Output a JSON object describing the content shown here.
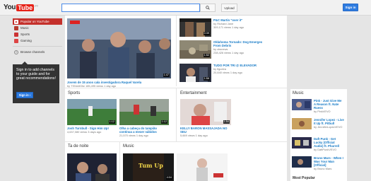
{
  "header": {
    "logo_you": "You",
    "logo_tube": "Tube",
    "logo_tld": "PT",
    "upload_label": "Upload",
    "signin_label": "Sign in"
  },
  "sidebar": {
    "items": [
      {
        "label": "Popular on YouTube",
        "color": "#ffffff"
      },
      {
        "label": "Music",
        "color": "#cc3333"
      },
      {
        "label": "Sports",
        "color": "#cc3333"
      },
      {
        "label": "Gaming",
        "color": "#cc3333"
      }
    ],
    "browse_label": "Browse channels",
    "signin_text": "Sign in to add channels to your guide and for great recommendations!",
    "signin_button": "Sign in ›"
  },
  "featured": {
    "title": "Jovem de 15 anos cala investigadora Raquel Varela",
    "channel": "by TSNmitGitz",
    "views": "185,495 views",
    "age": "1 day ago",
    "duration": "1:47"
  },
  "trending": [
    {
      "title": "P&C Martin \"over it\"",
      "channel": "by Richard Jane",
      "views": "309,171 views",
      "age": "1 day ago",
      "duration": "0:39"
    },
    {
      "title": "Oklahoma Tornado: Dog Emerges From Debris",
      "channel": "by cbsnews",
      "views": "238,426 views",
      "age": "1 day ago",
      "duration": "1:52"
    },
    {
      "title": "TUDO POR TRI @ ELEVADOR",
      "channel": "by figueira",
      "views": "20,840 views",
      "age": "1 day ago",
      "duration": "1:58"
    }
  ],
  "sections": {
    "sports": {
      "label": "Sports",
      "items": [
        {
          "title": "Josh Turnbull - Sign Him Up!",
          "views": "4,637,080 views",
          "age": "3 days ago",
          "duration": "1:12"
        },
        {
          "title": "Olha a cabeça do tampião contínua a mexer sábidos",
          "views": "21,570 views",
          "age": "1 day ago",
          "duration": "1:12"
        }
      ]
    },
    "entertainment": {
      "label": "Entertainment",
      "items": [
        {
          "title": "KELLY BARON MASSAJADA NO SEU",
          "views": "5,669 views",
          "age": "1 day ago",
          "duration": "1:54"
        }
      ]
    },
    "music_right": {
      "label": "Music",
      "items": [
        {
          "title": "Pink - Just Give Me A Reason ft. Nate Ruess",
          "channel": "by PinkVEVO"
        },
        {
          "title": "Jennifer Lopez - Live It Up ft. Pitbull",
          "channel": "by JenniferLopezVEVO"
        },
        {
          "title": "Daft Punk - Get Lucky (Official Audio) ft. Pharrell",
          "channel": "by DaftPunkVEVO"
        },
        {
          "title": "Bruno Mars - When I Was Your Man [Official]",
          "channel": "by Bruno Mars"
        }
      ]
    },
    "tanoite": {
      "label": "Ta de noite"
    },
    "music_bottom": {
      "label": "Music",
      "thumb_text": "Tum Up",
      "duration": "4:04"
    },
    "most_popular": {
      "label": "Most Popular"
    }
  }
}
